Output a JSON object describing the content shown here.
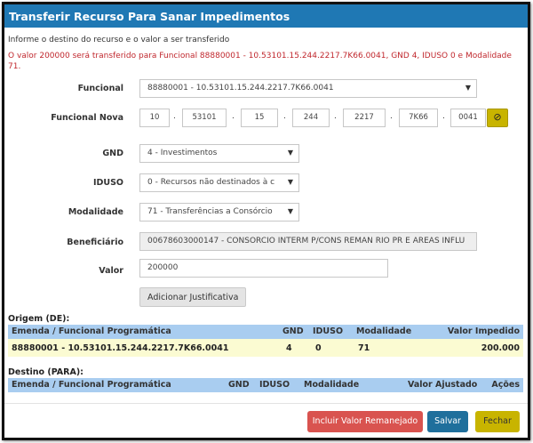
{
  "modal": {
    "title": "Transferir Recurso Para Sanar Impedimentos",
    "info": "Informe o destino do recurso e o valor a ser transferido",
    "warning": "O valor 200000 será transferido para Funcional 88880001 - 10.53101.15.244.2217.7K66.0041, GND 4, IDUSO 0 e Modalidade 71."
  },
  "form": {
    "funcional_label": "Funcional",
    "funcional_value": "88880001 - 10.53101.15.244.2217.7K66.0041",
    "funcional_nova_label": "Funcional Nova",
    "funcional_nova_segments": [
      "10",
      "53101",
      "15",
      "244",
      "2217",
      "7K66",
      "0041"
    ],
    "gnd_label": "GND",
    "gnd_value": "4 - Investimentos",
    "iduso_label": "IDUSO",
    "iduso_value": "0 - Recursos não destinados à c",
    "modalidade_label": "Modalidade",
    "modalidade_value": "71 - Transferências a Consórcio",
    "beneficiario_label": "Beneficiário",
    "beneficiario_value": "00678603000147 - CONSORCIO INTERM P/CONS REMAN RIO PR E AREAS INFLU",
    "valor_label": "Valor",
    "valor_value": "200000",
    "justificativa_button": "Adicionar Justificativa"
  },
  "origem": {
    "title": "Origem (DE):",
    "headers": [
      "Emenda / Funcional Programática",
      "GND",
      "IDUSO",
      "Modalidade",
      "Valor Impedido"
    ],
    "row": [
      "88880001 - 10.53101.15.244.2217.7K66.0041",
      "4",
      "0",
      "71",
      "200.000"
    ]
  },
  "destino": {
    "title": "Destino (PARA):",
    "headers": [
      "Emenda / Funcional Programática",
      "GND",
      "IDUSO",
      "Modalidade",
      "Valor Ajustado",
      "Ações"
    ]
  },
  "footer": {
    "incluir_button": "Incluir Valor Remanejado",
    "salvar_button": "Salvar",
    "fechar_button": "Fechar"
  },
  "colors": {
    "title_bar": "#1f78b4",
    "warning_text": "#c0272d",
    "incluir": "#d9534f",
    "salvar": "#1f6f9c",
    "fechar": "#c8b400"
  }
}
